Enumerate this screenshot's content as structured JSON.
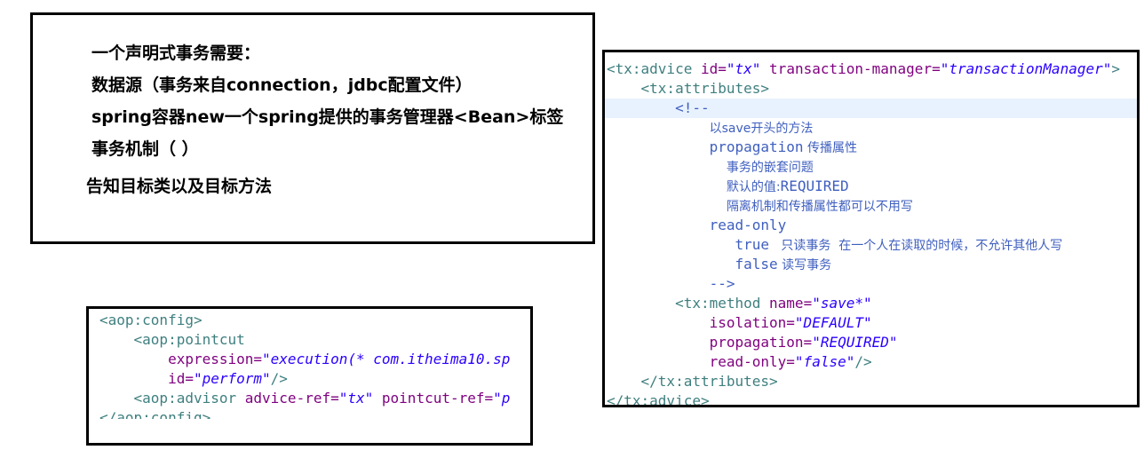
{
  "notes": {
    "lines": [
      "一个声明式事务需要：",
      "数据源（事务来自connection，jdbc配置文件）",
      "spring容器new一个spring提供的事务管理器<Bean>标签",
      "事务机制（ ）",
      "告知目标类以及目标方法"
    ]
  },
  "aop_config": {
    "l1": "<aop:config>",
    "l2": "<aop:pointcut",
    "l3_attr": "expression=",
    "l3_val": "\"execution(* com.itheima10.sp",
    "l4_attr": "id=",
    "l4_val": "\"perform\"",
    "l4_end": "/>",
    "l5_tag": "<aop:advisor",
    "l5_attr1": "advice-ref=",
    "l5_val1": "\"tx\"",
    "l5_attr2": "pointcut-ref=",
    "l5_val2": "\"p",
    "l6": "</aop:config>"
  },
  "tx_advice": {
    "l1_tag": "<tx:advice",
    "l1_attr1": "id=",
    "l1_val1": "\"tx\"",
    "l1_attr2": "transaction-manager=",
    "l1_val2": "\"transactionManager\"",
    "l1_end": ">",
    "l2": "<tx:attributes>",
    "l3": "<!--",
    "l4": "以save开头的方法",
    "l5_a": "propagation",
    "l5_b": " 传播属性",
    "l6": "事务的嵌套问题",
    "l7_a": "默认的值:",
    "l7_b": "REQUIRED",
    "l8": "隔离机制和传播属性都可以不用写",
    "l9": "read-only",
    "l10_a": "true",
    "l10_b": "   只读事务  在一个人在读取的时候，不允许其他人写",
    "l11_a": "false",
    "l11_b": " 读写事务",
    "l12": "-->",
    "l13_tag": "<tx:method",
    "l13_attr": "name=",
    "l13_val": "\"save*\"",
    "l14_attr": "isolation=",
    "l14_val": "\"DEFAULT\"",
    "l15_attr": "propagation=",
    "l15_val": "\"REQUIRED\"",
    "l16_attr": "read-only=",
    "l16_val": "\"false\"",
    "l16_end": "/>",
    "l17": "</tx:attributes>",
    "l18": "</tx:advice>"
  }
}
